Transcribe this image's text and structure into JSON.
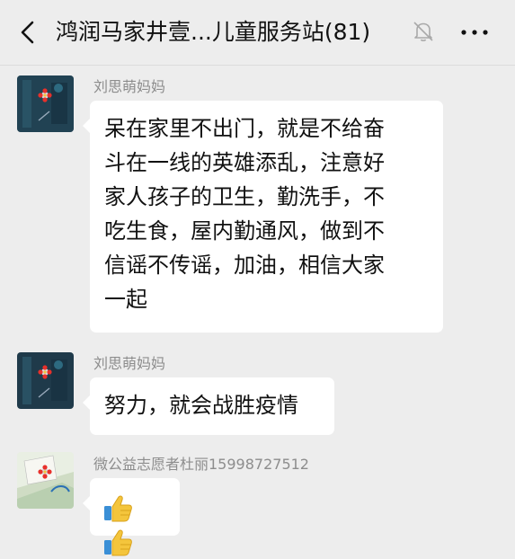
{
  "header": {
    "title": "鸿润马家井壹...儿童服务站(81)",
    "back_icon": "chevron-left-icon",
    "mute_icon": "bell-off-icon",
    "more_icon": "more-dots-icon"
  },
  "messages": [
    {
      "sender": "刘思萌妈妈",
      "lines": [
        "呆在家里不出门，就是不给奋",
        "斗在一线的英雄添乱，注意好",
        "家人孩子的卫生，勤洗手，不",
        "吃生食，屋内勤通风，做到不",
        "信谣不传谣，加油，相信大家",
        "一起"
      ]
    },
    {
      "sender": "刘思萌妈妈",
      "lines": [
        "努力，就会战胜疫情"
      ]
    },
    {
      "sender": "微公益志愿者杜丽15998727512",
      "emoji": [
        "thumbs-up-icon",
        "thumbs-up-icon"
      ]
    }
  ],
  "colors": {
    "background": "#ededed",
    "bubble": "#ffffff",
    "sender_text": "#8d8d8d"
  }
}
